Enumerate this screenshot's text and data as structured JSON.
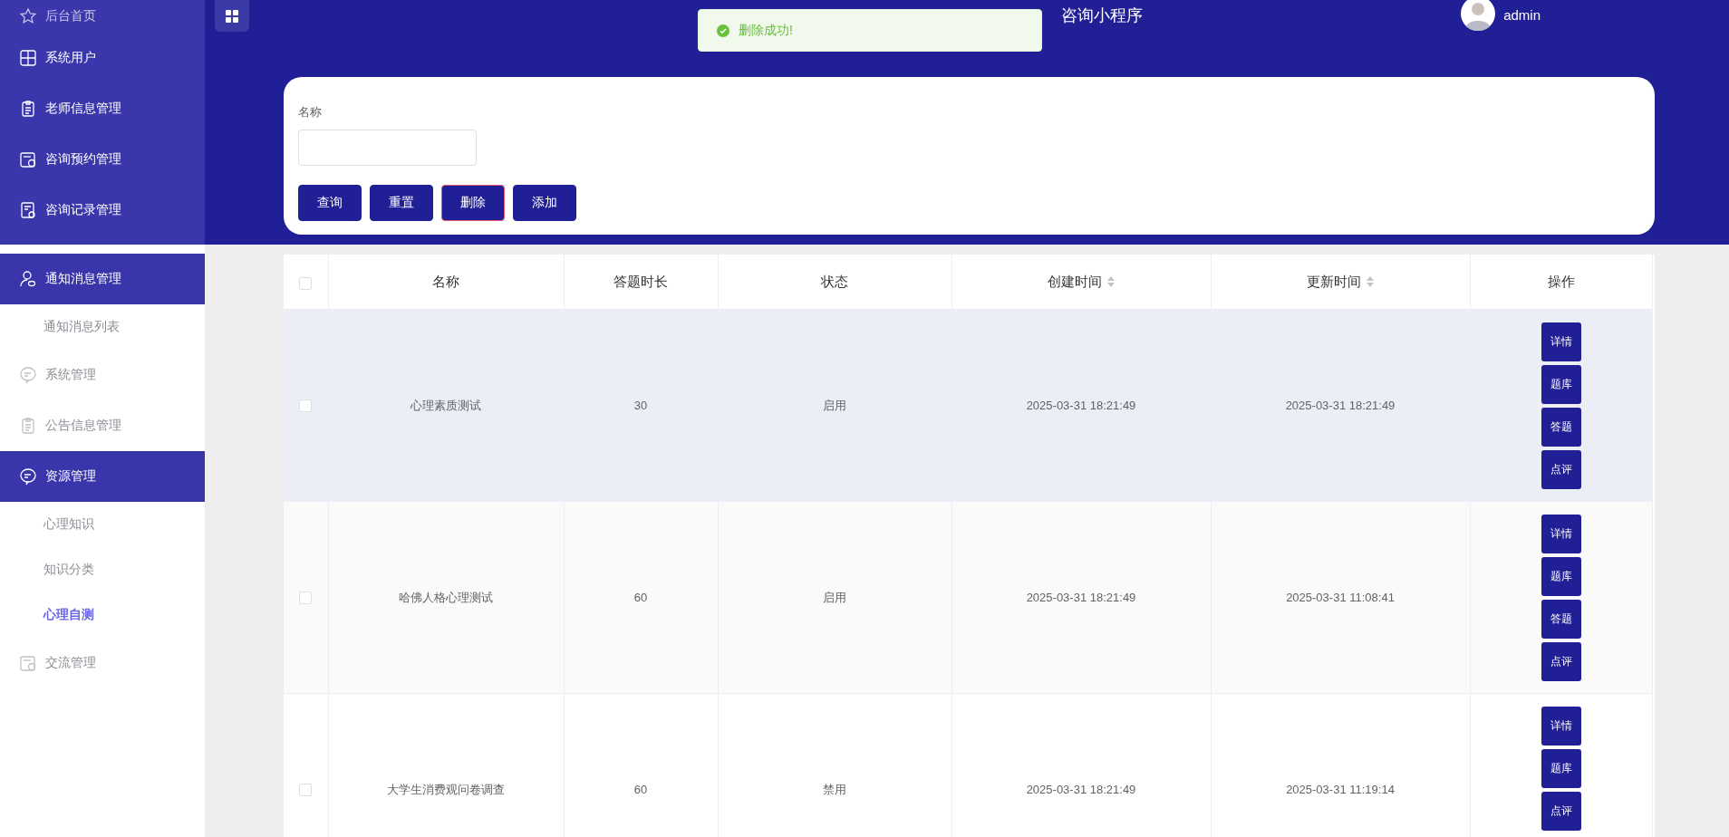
{
  "sidebar": {
    "top_items": [
      {
        "label": "后台首页"
      },
      {
        "label": "系统用户"
      },
      {
        "label": "老师信息管理"
      },
      {
        "label": "咨询预约管理"
      },
      {
        "label": "咨询记录管理"
      }
    ],
    "items": [
      {
        "label": "通知消息管理",
        "kind": "group",
        "selected": true
      },
      {
        "label": "通知消息列表",
        "kind": "sub",
        "selected": false
      },
      {
        "label": "系统管理",
        "kind": "group",
        "selected": false
      },
      {
        "label": "公告信息管理",
        "kind": "group",
        "selected": false
      },
      {
        "label": "资源管理",
        "kind": "group",
        "selected": true
      },
      {
        "label": "心理知识",
        "kind": "sub",
        "selected": false
      },
      {
        "label": "知识分类",
        "kind": "sub",
        "selected": false
      },
      {
        "label": "心理自测",
        "kind": "sub",
        "selected": true
      },
      {
        "label": "交流管理",
        "kind": "group",
        "selected": false
      }
    ]
  },
  "header": {
    "title": "咨询小程序",
    "username": "admin"
  },
  "toast": {
    "kind": "success",
    "message": "删除成功!"
  },
  "search": {
    "label": "名称",
    "buttons": [
      {
        "label": "查询",
        "focused": false
      },
      {
        "label": "重置",
        "focused": false
      },
      {
        "label": "删除",
        "focused": true
      },
      {
        "label": "添加",
        "focused": false
      }
    ]
  },
  "table": {
    "select_all": false,
    "columns": [
      {
        "label": "名称",
        "sortable": false
      },
      {
        "label": "答题时长",
        "sortable": false
      },
      {
        "label": "状态",
        "sortable": false
      },
      {
        "label": "创建时间",
        "sortable": true
      },
      {
        "label": "更新时间",
        "sortable": true
      },
      {
        "label": "操作",
        "sortable": false
      }
    ],
    "rows": [
      {
        "checked": false,
        "highlighted": true,
        "cells": [
          "心理素质测试",
          "30",
          "启用",
          "2025-03-31 18:21:49",
          "2025-03-31 18:21:49"
        ],
        "actions": [
          "详情",
          "题库",
          "答题",
          "点评"
        ]
      },
      {
        "checked": false,
        "highlighted": false,
        "cells": [
          "哈佛人格心理测试",
          "60",
          "启用",
          "2025-03-31 18:21:49",
          "2025-03-31 11:08:41"
        ],
        "actions": [
          "详情",
          "题库",
          "答题",
          "点评"
        ]
      },
      {
        "checked": false,
        "highlighted": false,
        "cells": [
          "大学生消费观问卷调查",
          "60",
          "禁用",
          "2025-03-31 18:21:49",
          "2025-03-31 11:19:14"
        ],
        "actions": [
          "详情",
          "题库",
          "点评"
        ]
      }
    ]
  }
}
